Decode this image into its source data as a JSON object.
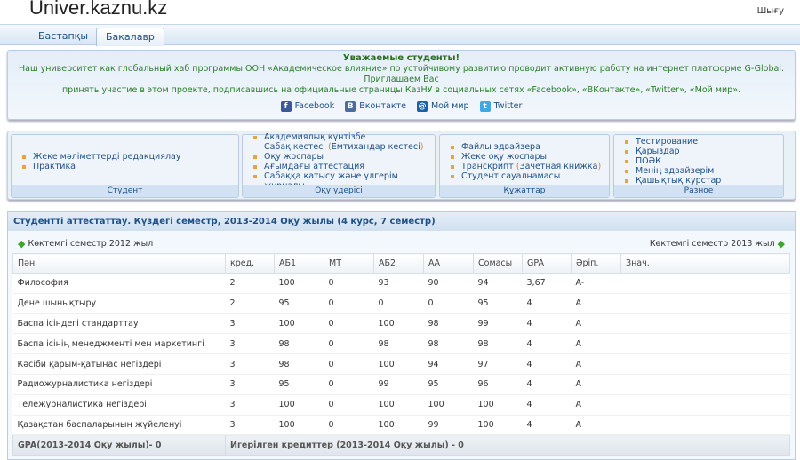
{
  "header": {
    "logo": "Univer.kaznu.kz",
    "logout": "Шығу"
  },
  "tabs": [
    {
      "label": "Бастапқы",
      "active": false
    },
    {
      "label": "Бакалавр",
      "active": true
    }
  ],
  "notice": {
    "title": "Уважаемые студенты!",
    "line1": "Наш университет как глобальный хаб программы ООН «Академическое влияние» по устойчивому развитию проводит активную работу на интернет платформе G-Global. Приглашаем Вас",
    "line2": "принять участие в этом проекте, подписавшись на официальные страницы КазНУ в социальных сетях «Facebook», «ВКонтакте», «Twitter», «Мой мир».",
    "social": [
      {
        "label": "Facebook",
        "icon": "facebook-icon",
        "color": "#3b5998",
        "glyph": "f"
      },
      {
        "label": "Вконтакте",
        "icon": "vkontakte-icon",
        "color": "#4a6d9a",
        "glyph": "B"
      },
      {
        "label": "Мой мир",
        "icon": "moimir-icon",
        "color": "#1a5fa8",
        "glyph": "@"
      },
      {
        "label": "Twitter",
        "icon": "twitter-icon",
        "color": "#3fa9e6",
        "glyph": "t"
      }
    ]
  },
  "menus": [
    {
      "title": "Студент",
      "items": [
        "Жеке мәліметтерді редакциялау",
        "Практика"
      ]
    },
    {
      "title": "Оқу үдерісі",
      "items": [
        "Академиялық күнтізбе",
        "Сабақ кестесі",
        "Оқу жоспары",
        "Ағымдағы аттестация",
        "Сабаққа қатысу және үлгерім журналы"
      ],
      "extra": "Емтихандар кестесі"
    },
    {
      "title": "Құжаттар",
      "items": [
        "Файлы эдвайзера",
        "Жеке оқу жоспары",
        "Транскрипт",
        "Студент сауалнамасы"
      ],
      "extra": "Зачетная книжка"
    },
    {
      "title": "Разное",
      "items": [
        "Тестирование",
        "Қарыздар",
        "ПОӘК",
        "Менің эдвайзерім",
        "Қашықтық курстар"
      ]
    }
  ],
  "section": {
    "title": "Студентті аттестаттау. Күздегі семестр, 2013-2014 Оқу жылы (4 курс, 7 семестр)",
    "prev": "Көктемгі семестр 2012 жыл",
    "next": "Көктемгі семестр 2013 жыл"
  },
  "table": {
    "columns": [
      "Пән",
      "кред.",
      "АБ1",
      "МТ",
      "АБ2",
      "АА",
      "Сомасы",
      "GPA",
      "Әріп.",
      "Знач."
    ],
    "rows": [
      [
        "Философия",
        "2",
        "100",
        "0",
        "93",
        "90",
        "94",
        "3,67",
        "A-",
        ""
      ],
      [
        "Дене шынықтыру",
        "2",
        "95",
        "0",
        "0",
        "0",
        "95",
        "4",
        "A",
        ""
      ],
      [
        "Баспа ісіндегі стандарттау",
        "3",
        "100",
        "0",
        "100",
        "98",
        "99",
        "4",
        "A",
        ""
      ],
      [
        "Баспа ісінің менеджменті мен маркетингі",
        "3",
        "98",
        "0",
        "98",
        "98",
        "98",
        "4",
        "A",
        ""
      ],
      [
        "Кәсіби қарым-қатынас негіздері",
        "3",
        "98",
        "0",
        "100",
        "94",
        "97",
        "4",
        "A",
        ""
      ],
      [
        "Радиожурналистика негіздері",
        "3",
        "95",
        "0",
        "99",
        "95",
        "96",
        "4",
        "A",
        ""
      ],
      [
        "Тележурналистика негіздері",
        "3",
        "100",
        "0",
        "100",
        "100",
        "100",
        "4",
        "A",
        ""
      ],
      [
        "Қазақстан баспаларының жүйеленуі",
        "3",
        "100",
        "0",
        "100",
        "99",
        "100",
        "4",
        "A",
        ""
      ]
    ],
    "footer_gpa": "GPA(2013-2014 Оқу жылы)- 0",
    "footer_credits": "Игерілген кредиттер (2013-2014 Оқу жылы) - 0"
  }
}
